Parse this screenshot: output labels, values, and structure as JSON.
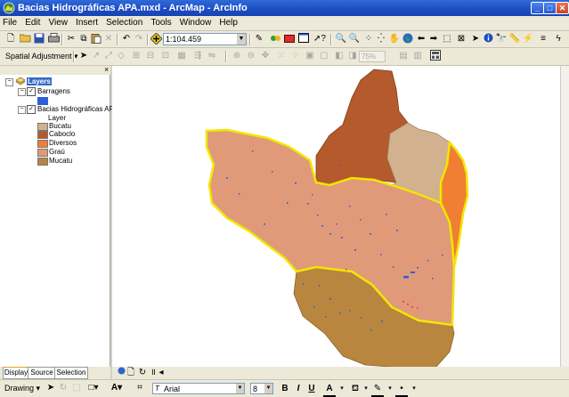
{
  "window": {
    "title": "Bacias Hidrográficas APA.mxd - ArcMap - ArcInfo",
    "minimize": "_",
    "maximize": "□",
    "close": "✕"
  },
  "menu": [
    {
      "key": "F",
      "rest": "ile"
    },
    {
      "key": "E",
      "rest": "dit"
    },
    {
      "key": "V",
      "rest": "iew"
    },
    {
      "key": "I",
      "rest": "nsert",
      "prefix": ""
    },
    {
      "key": "S",
      "rest": "election"
    },
    {
      "key": "T",
      "rest": "ools"
    },
    {
      "key": "W",
      "rest": "indow"
    },
    {
      "key": "H",
      "rest": "elp"
    }
  ],
  "menu_labels": [
    "File",
    "Edit",
    "View",
    "Insert",
    "Selection",
    "Tools",
    "Window",
    "Help"
  ],
  "standard_toolbar": {
    "scale": "1:104.459"
  },
  "editor_toolbar": {
    "spatial_adjustment": "Spatial Adjustment ▾",
    "zoom_pct": "75%"
  },
  "toc": {
    "root": "Layers",
    "layers": [
      {
        "name": "Barragens",
        "checked": true,
        "symbols": [
          {
            "label": "",
            "color": "#2d5fd6"
          }
        ]
      },
      {
        "name": "Bacias Hidrográficas APA",
        "checked": true,
        "field": "Layer",
        "symbols": [
          {
            "label": "Bucatu",
            "color": "#d2b18f"
          },
          {
            "label": "Caboclo",
            "color": "#b55a2c"
          },
          {
            "label": "Diversos",
            "color": "#f07f33"
          },
          {
            "label": "Graú",
            "color": "#e09a7a"
          },
          {
            "label": "Mucatu",
            "color": "#b8863f"
          }
        ]
      }
    ],
    "tabs": [
      "Display",
      "Source",
      "Selection"
    ]
  },
  "drawing_toolbar": {
    "drawing": "Drawing ▾",
    "font": "Arial",
    "size": "8",
    "bold": "B",
    "italic": "I",
    "underline": "U",
    "font_color_letter": "A"
  },
  "colors": {
    "boundary": "#f2e600",
    "waterbody": "#2d5fd6",
    "highlight": "#e8332a"
  }
}
